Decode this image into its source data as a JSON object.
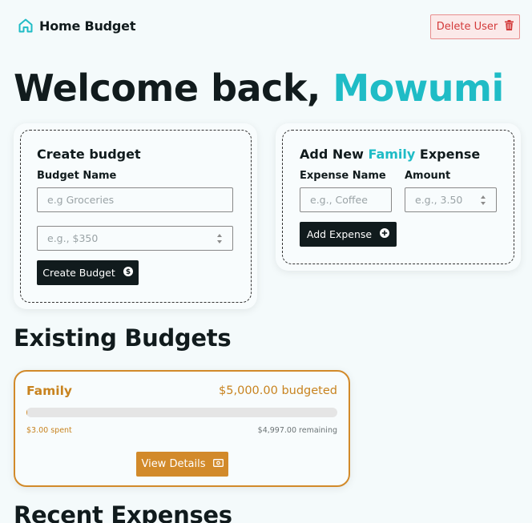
{
  "header": {
    "brand_name": "Home Budget",
    "delete_label": "Delete User"
  },
  "welcome": {
    "prefix": "Welcome back, ",
    "user_name": "Mowumi"
  },
  "create_budget": {
    "title": "Create budget",
    "name_label": "Budget Name",
    "name_placeholder": "e.g Groceries",
    "amount_placeholder": "e.g., $350",
    "button_label": "Create Budget"
  },
  "add_expense": {
    "title_prefix": "Add New ",
    "title_budget": "Family",
    "title_suffix": " Expense",
    "name_label": "Expense Name",
    "name_placeholder": "e.g., Coffee",
    "amount_label": "Amount",
    "amount_placeholder": "e.g., 3.50",
    "button_label": "Add Expense"
  },
  "existing_budgets": {
    "title": "Existing Budgets",
    "items": [
      {
        "name": "Family",
        "budgeted": "$5,000.00 budgeted",
        "spent": "$3.00 spent",
        "remaining": "$4,997.00 remaining",
        "progress": 0.0006,
        "button_label": "View Details",
        "color": "#d28a2a"
      }
    ]
  },
  "recent_expenses": {
    "title": "Recent Expenses"
  },
  "colors": {
    "accent": "#1fbcc6",
    "dark": "#111b1d",
    "danger": "#d33a3a",
    "budget": "#d28a2a"
  },
  "icons": [
    "home-icon",
    "trash-icon",
    "plus-circle-icon",
    "dollar-circle-icon",
    "banknote-icon"
  ]
}
